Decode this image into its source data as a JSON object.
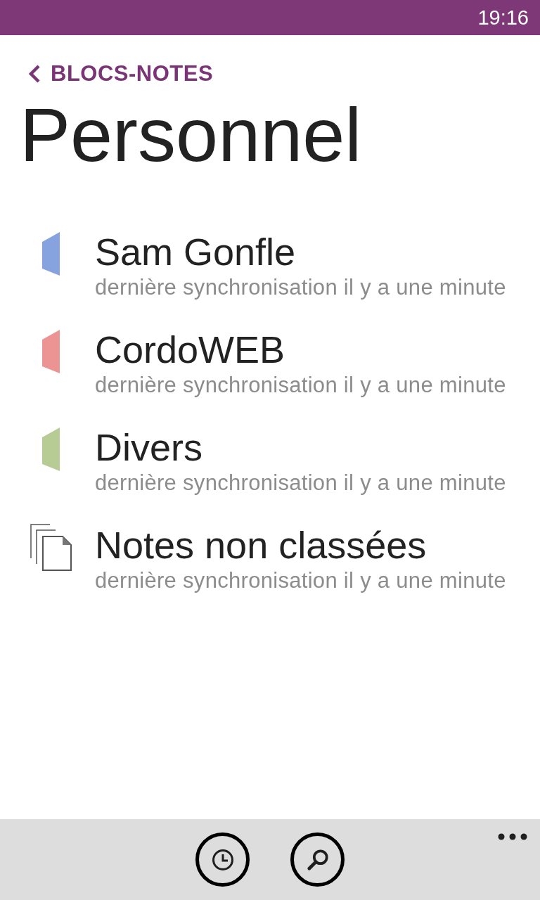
{
  "status_bar": {
    "time": "19:16"
  },
  "header": {
    "back_link": "BLOCS-NOTES",
    "title": "Personnel"
  },
  "notebooks": [
    {
      "kind": "section",
      "name": "Sam Gonfle",
      "subtitle": "dernière synchronisation il y a une minute",
      "color": "#86a3e0"
    },
    {
      "kind": "section",
      "name": "CordoWEB",
      "subtitle": "dernière synchronisation il y a une minute",
      "color": "#ec9394"
    },
    {
      "kind": "section",
      "name": "Divers",
      "subtitle": "dernière synchronisation il y a une minute",
      "color": "#b7cc95"
    },
    {
      "kind": "unfiled",
      "name": "Notes non classées",
      "subtitle": "dernière synchronisation il y a une minute"
    }
  ],
  "app_bar": {
    "buttons": [
      {
        "kind": "recent"
      },
      {
        "kind": "search"
      }
    ]
  }
}
